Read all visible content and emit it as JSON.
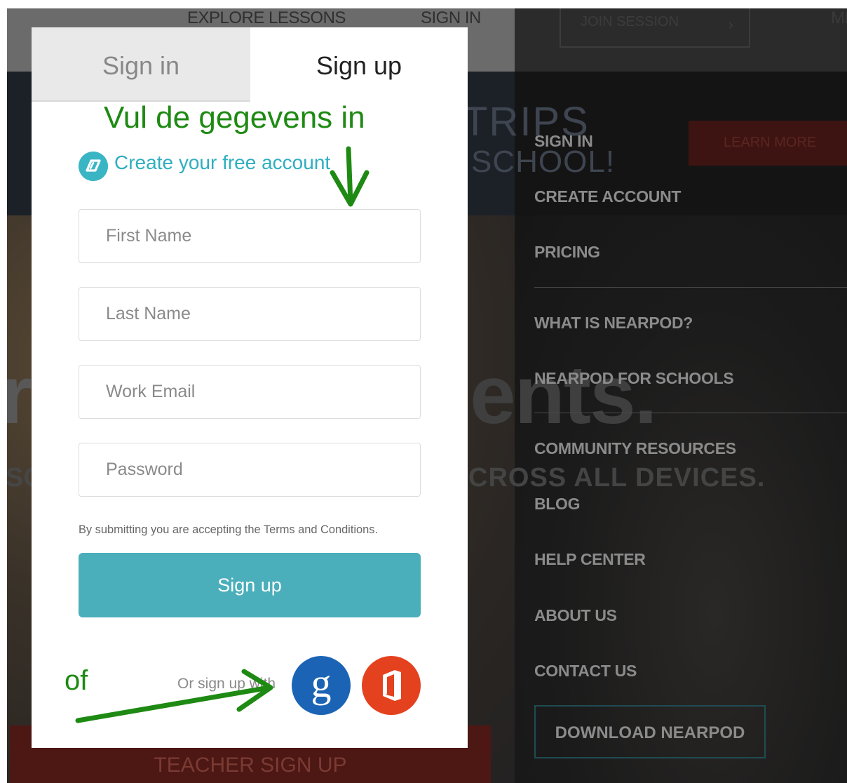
{
  "topnav": {
    "explore": "EXPLORE LESSONS",
    "signin": "SIGN IN",
    "join_session": "JOIN SESSION",
    "more": "ME"
  },
  "band": {
    "title": "TRIPS",
    "subtitle": "SCHOOL!",
    "learn_more": "LEARN MORE"
  },
  "hero": {
    "headline_left": "r",
    "headline_right": "dents.",
    "sub_left": "SC",
    "sub_right": "CROSS ALL DEVICES.",
    "teacher_signup": "TEACHER SIGN UP"
  },
  "side_menu": {
    "items": [
      "SIGN IN",
      "CREATE ACCOUNT",
      "PRICING",
      "WHAT IS NEARPOD?",
      "NEARPOD FOR SCHOOLS",
      "COMMUNITY RESOURCES",
      "BLOG",
      "HELP CENTER",
      "ABOUT US",
      "CONTACT US"
    ],
    "download": "DOWNLOAD NEARPOD"
  },
  "modal": {
    "tab_signin": "Sign in",
    "tab_signup": "Sign up",
    "create_account": "Create your free account",
    "fields": {
      "first_name": "First Name",
      "last_name": "Last Name",
      "work_email": "Work Email",
      "password": "Password"
    },
    "terms": "By submitting you are accepting the Terms and Conditions.",
    "signup_button": "Sign up",
    "or_sign_up_with": "Or sign up with",
    "google_glyph": "g"
  },
  "annotations": {
    "title": "Vul de gegevens in",
    "of": "of",
    "color": "#1e8a13"
  },
  "colors": {
    "accent": "#4aafbb",
    "link": "#2faec0",
    "google": "#1b64b5",
    "office": "#e4411e"
  },
  "icons": [
    "nearpod-logo-icon",
    "google-icon",
    "office-icon",
    "arrow-down-icon",
    "arrow-right-icon",
    "chevron-right-icon"
  ]
}
